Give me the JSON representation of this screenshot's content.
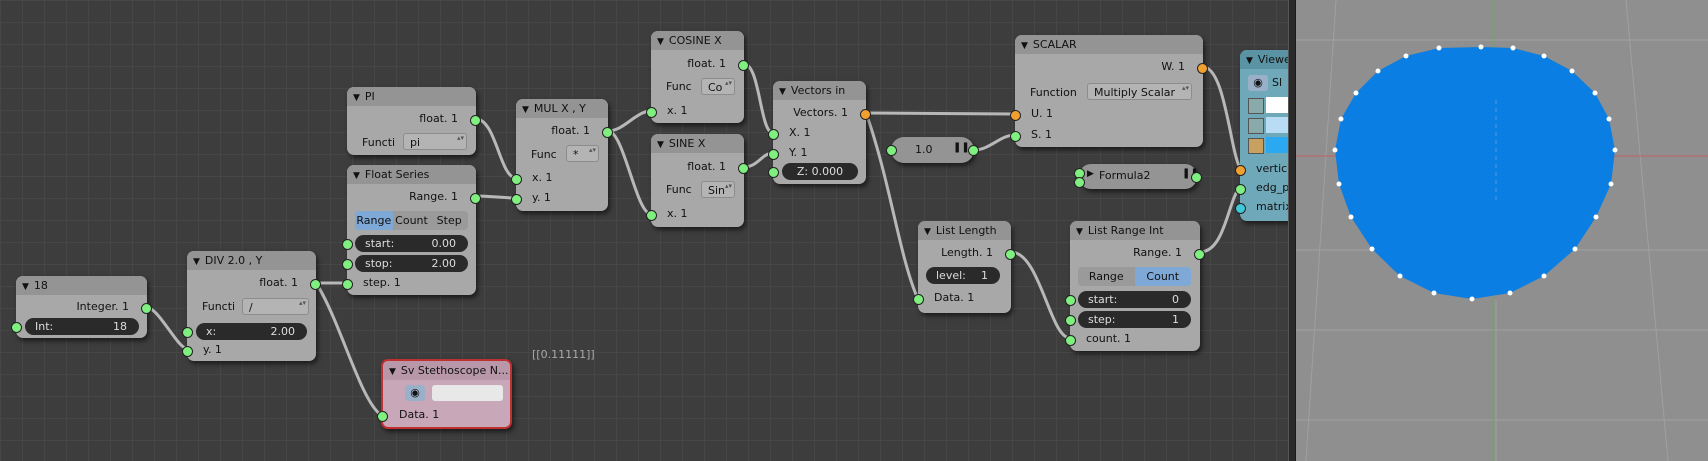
{
  "nodes": {
    "int": {
      "title": "18",
      "out": "Integer. 1",
      "field_label": "Int:",
      "field_value": "18"
    },
    "div": {
      "title": "DIV 2.0 ,  Y",
      "out": "float. 1",
      "func_label": "Functi",
      "func_value": "/",
      "x_label": "x:",
      "x_value": "2.00",
      "in_y": "y. 1"
    },
    "pi": {
      "title": "PI",
      "out": "float. 1",
      "func_label": "Functi",
      "func_value": "pi"
    },
    "float_series": {
      "title": "Float Series",
      "out": "Range. 1",
      "modes": [
        "Range",
        "Count",
        "Step"
      ],
      "start_label": "start:",
      "start_value": "0.00",
      "stop_label": "stop:",
      "stop_value": "2.00",
      "in_step": "step. 1"
    },
    "mul": {
      "title": "MUL X ,  Y",
      "out": "float. 1",
      "func_label": "Func",
      "func_value": "*",
      "in_x": "x. 1",
      "in_y": "y. 1"
    },
    "cosine": {
      "title": "COSINE X",
      "out": "float. 1",
      "func_label": "Func",
      "func_value": "Co",
      "in_x": "x. 1"
    },
    "sine": {
      "title": "SINE X",
      "out": "float. 1",
      "func_label": "Func",
      "func_value": "Sin",
      "in_x": "x. 1"
    },
    "vectors_in": {
      "title": "Vectors in",
      "out": "Vectors. 1",
      "in_x": "X. 1",
      "in_y": "Y. 1",
      "z_field": "Z: 0.000"
    },
    "value_node": {
      "value": "1.0"
    },
    "scalar": {
      "title": "SCALAR",
      "out": "W. 1",
      "func_label": "Function",
      "func_value": "Multiply Scalar",
      "in_u": "U. 1",
      "in_s": "S. 1"
    },
    "formula": {
      "title": "Formula2"
    },
    "list_length": {
      "title": "List Length",
      "out": "Length. 1",
      "level_label": "level:",
      "level_value": "1",
      "in_data": "Data. 1"
    },
    "list_range": {
      "title": "List Range Int",
      "out": "Range. 1",
      "modes": [
        "Range",
        "Count"
      ],
      "start_label": "start:",
      "start_value": "0",
      "step_label": "step:",
      "step_value": "1",
      "in_count": "count. 1"
    },
    "stethoscope": {
      "title": "Sv Stethoscope N...",
      "in_data": "Data. 1",
      "output_text": "[[0.11111]]"
    },
    "viewer": {
      "title": "Viewe",
      "sub": "Sl",
      "in_vertices": "vertice",
      "in_edges": "edg_pa",
      "in_matrix": "matrix"
    }
  },
  "colors": {
    "grid_bg": "#3d3d3d",
    "node_body": "#a8a8a8",
    "socket_green": "#7ff07f",
    "socket_orange": "#f0a030",
    "mesh_fill": "#0a7ee2",
    "stethoscope_body": "#c8a8b8",
    "viewer_header": "#6fa8b8"
  }
}
